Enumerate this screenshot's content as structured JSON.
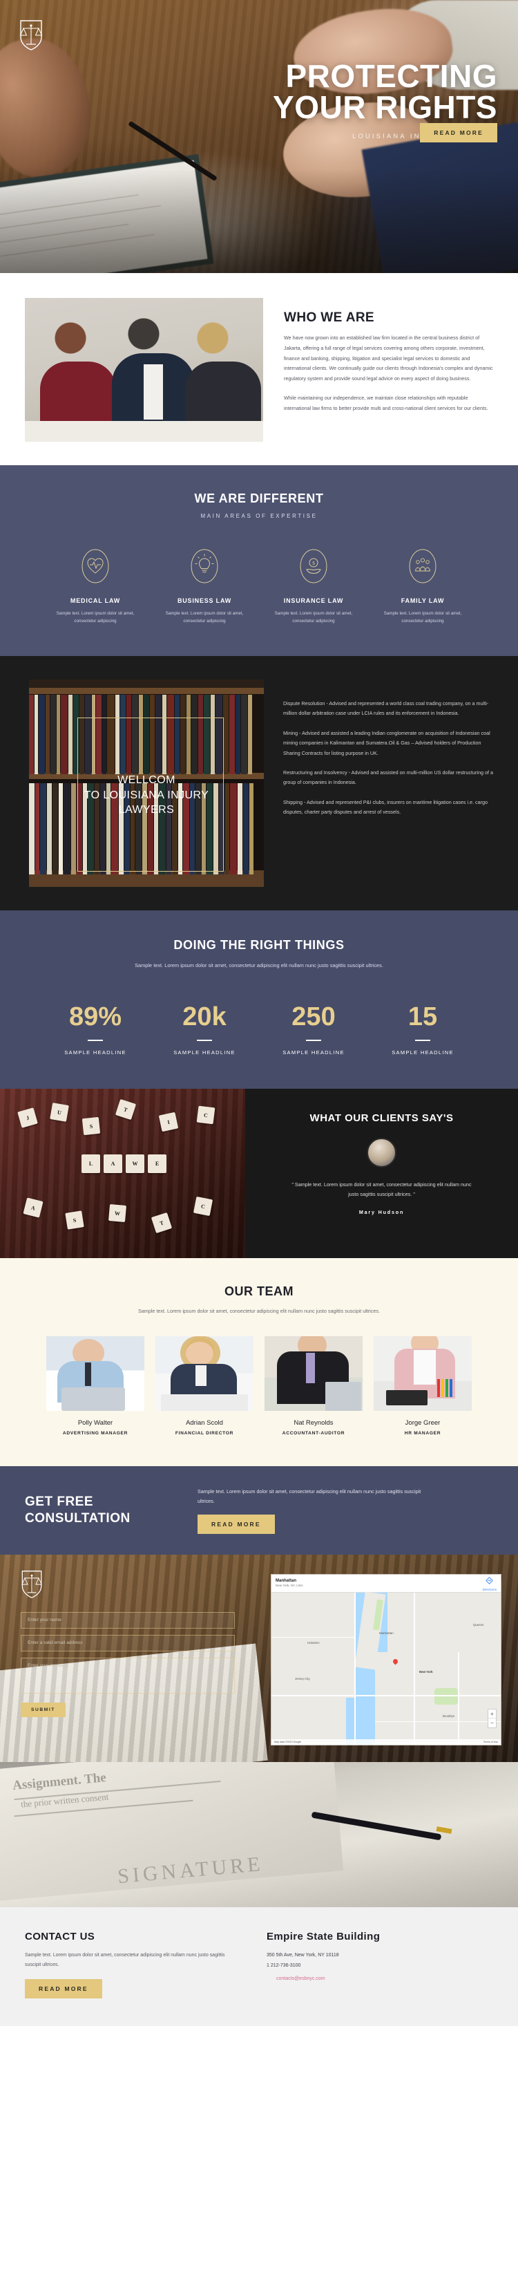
{
  "hero": {
    "logo_icon": "scales-of-justice-shield-icon",
    "title_line1": "Protecting",
    "title_line2": "Your Rights",
    "subtitle": "Louisiana Injury Lawyers",
    "cta_label": "Read More"
  },
  "who": {
    "heading": "Who We Are",
    "paragraph1": "We have now grown into an established law firm located in the central business district of Jakarta, offering a full range of legal services covering among others corporate, investment, finance and banking, shipping, litigation and specialist legal services to domestic and international clients. We continually guide our clients through Indonesia's complex and dynamic regulatory system and provide sound legal advice on every aspect of doing business.",
    "paragraph2": "While maintaining our independence, we maintain close relationships with reputable international law firms to better provide multi and cross-national client services for our clients."
  },
  "different": {
    "heading": "We Are Different",
    "subheading": "Main Areas Of Expertise",
    "cards": [
      {
        "icon": "heart-pulse-icon",
        "title": "Medical Law",
        "text": "Sample text. Lorem ipsum dolor sit amet, consectetur adipiscing"
      },
      {
        "icon": "lightbulb-icon",
        "title": "Business Law",
        "text": "Sample text. Lorem ipsum dolor sit amet, consectetur adipiscing"
      },
      {
        "icon": "hand-money-icon",
        "title": "Insurance Law",
        "text": "Sample text. Lorem ipsum dolor sit amet, consectetur adipiscing"
      },
      {
        "icon": "family-group-icon",
        "title": "Family Law",
        "text": "Sample text. Lorem ipsum dolor sit amet, consectetur adipiscing"
      }
    ]
  },
  "library": {
    "overlay_line1": "Wellcom",
    "overlay_line2": "To Louisiana Injury",
    "overlay_line3": "Lawyers",
    "paragraphs": [
      "Dispute Resolution - Advised and represented a world class coal trading company, on a multi-million dollar arbitration case under LCIA rules and its enforcement in Indonesia.",
      "Mining - Advised and assisted a leading Indian conglomerate on acquisition of Indonesian coal mining companies in Kalimantan and Sumatera.Oil & Gas – Advised holders of Production Sharing Contracts for listing purpose in UK.",
      "Restructuring and Insolvency - Advised and assisted on multi-million US dollar restructuring of a group of companies in Indonesia.",
      "Shipping - Advised and represented P&I clubs, insurers on maritime litigation cases i.e. cargo disputes, charter party disputes and arrest of vessels."
    ]
  },
  "stats": {
    "heading": "Doing The Right Things",
    "subtext": "Sample text. Lorem ipsum dolor sit amet, consectetur adipiscing elit nullam nunc justo sagittis suscipit ultrices.",
    "items": [
      {
        "value": "89%",
        "label": "Sample Headline"
      },
      {
        "value": "20k",
        "label": "Sample Headline"
      },
      {
        "value": "250",
        "label": "Sample Headline"
      },
      {
        "value": "15",
        "label": "Sample Headline"
      }
    ]
  },
  "testimonial": {
    "heading": "What Our Clients Say's",
    "quote": "\" Sample text. Lorem ipsum dolor sit amet, consectetur adipiscing elit nullam nunc justo sagittis suscipit ultrices. \"",
    "author": "Mary Hudson",
    "tiles": [
      "L",
      "A",
      "W",
      "J",
      "U",
      "S",
      "T",
      "I",
      "C",
      "E"
    ]
  },
  "team": {
    "heading": "Our Team",
    "subtext": "Sample text. Lorem ipsum dolor sit amet, consectetur adipiscing elit nullam nunc justo sagittis suscipit ultrices.",
    "members": [
      {
        "name": "Polly Walter",
        "role": "Advertising Manager"
      },
      {
        "name": "Adrian Scold",
        "role": "Financial Director"
      },
      {
        "name": "Nat Reynolds",
        "role": "Accountant-Auditor"
      },
      {
        "name": "Jorge Greer",
        "role": "HR Manager"
      }
    ]
  },
  "consultation": {
    "heading_line1": "Get Free",
    "heading_line2": "Consultation",
    "text": "Sample text. Lorem ipsum dolor sit amet, consectetur adipiscing elit nullam nunc justo sagittis suscipit ultrices.",
    "cta_label": "Read More"
  },
  "contact_form": {
    "logo_icon": "scales-of-justice-shield-icon",
    "name_placeholder": "Enter your name",
    "email_placeholder": "Enter a valid email address",
    "message_placeholder": "Enter your message",
    "submit_label": "Submit"
  },
  "map": {
    "title": "Manhattan",
    "subtitle": "New York, NY, USA",
    "directions_label": "Directions",
    "zoom_in": "+",
    "zoom_out": "−",
    "labels": [
      "New York",
      "Hoboken",
      "Jersey City",
      "Brooklyn",
      "Manhattan",
      "Queens"
    ],
    "attribution_left": "Map data ©2019 Google",
    "attribution_right": "Terms of Use"
  },
  "footer": {
    "contact_heading": "Contact Us",
    "contact_text": "Sample text. Lorem ipsum dolor sit amet, consectetur adipiscing elit nullam nunc justo sagittis suscipit ultrices.",
    "contact_cta": "Read More",
    "address_heading": "Empire State Building",
    "address_line": "350 5th Ave, New York, NY 10118",
    "phone": "1 212-736-3100",
    "email": "contacts@esbnyc.com"
  },
  "colors": {
    "gold": "#e3c87e",
    "slate": "#474c68",
    "slate_light": "#4e5370",
    "cream": "#fbf7ea",
    "dark": "#1c1c1c",
    "pink_link": "#d46a8e"
  }
}
